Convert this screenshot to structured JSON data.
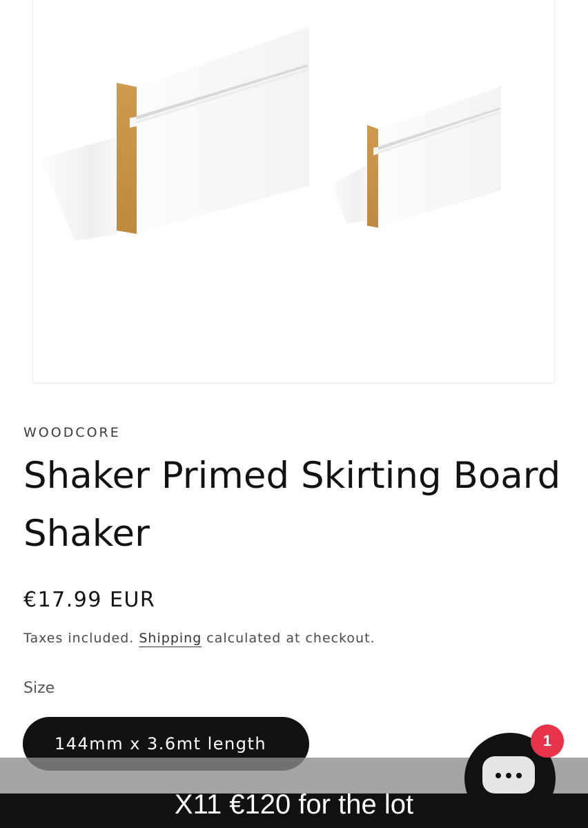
{
  "product": {
    "vendor": "WOODCORE",
    "title": "Shaker Primed Skirting Board Shaker",
    "price": "€17.99 EUR",
    "tax_note_before": "Taxes included. ",
    "tax_note_link": "Shipping",
    "tax_note_after": " calculated at checkout.",
    "size_label": "Size",
    "selected_size": "144mm x 3.6mt length",
    "image_icon": "skirting-board-product-image"
  },
  "chat": {
    "icon": "chat-bubble-icon",
    "badge_count": "1",
    "badge_color": "#e8344a"
  },
  "caption": {
    "text": "X11 €120 for the lot"
  }
}
